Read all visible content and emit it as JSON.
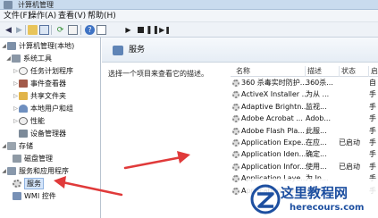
{
  "window": {
    "title": "计算机管理"
  },
  "menu": [
    "文件(F)",
    "操作(A)",
    "查看(V)",
    "帮助(H)"
  ],
  "toolbar": {
    "icons": [
      "back-arrow-icon",
      "forward-arrow-icon",
      "folder-up-icon",
      "console-tree-icon",
      "refresh-icon",
      "export-list-icon",
      "help-icon",
      "properties-icon",
      "play-icon",
      "stop-icon",
      "pause-icon",
      "restart-icon"
    ]
  },
  "tree": {
    "root": "计算机管理(本地)",
    "items": [
      {
        "label": "系统工具",
        "icon": "tools-icon"
      },
      {
        "label": "任务计划程序",
        "icon": "clock-icon"
      },
      {
        "label": "事件查看器",
        "icon": "event-viewer-icon"
      },
      {
        "label": "共享文件夹",
        "icon": "shared-folder-icon"
      },
      {
        "label": "本地用户和组",
        "icon": "users-icon"
      },
      {
        "label": "性能",
        "icon": "performance-icon"
      },
      {
        "label": "设备管理器",
        "icon": "device-manager-icon"
      },
      {
        "label": "存储",
        "icon": "storage-icon"
      },
      {
        "label": "磁盘管理",
        "icon": "disk-icon"
      },
      {
        "label": "服务和应用程序",
        "icon": "services-apps-icon"
      },
      {
        "label": "服务",
        "icon": "services-icon"
      },
      {
        "label": "WMI 控件",
        "icon": "wmi-icon"
      }
    ]
  },
  "center": {
    "title": "服务",
    "description": "选择一个项目来查看它的描述。"
  },
  "services": {
    "columns": [
      "名称",
      "描述",
      "状态",
      "启"
    ],
    "rows": [
      {
        "name": "360 杀毒实时防护...",
        "desc": "360杀...",
        "status": "",
        "start": "自"
      },
      {
        "name": "ActiveX Installer ...",
        "desc": "为从 ...",
        "status": "",
        "start": "手"
      },
      {
        "name": "Adaptive Brightn...",
        "desc": "监视...",
        "status": "",
        "start": "手"
      },
      {
        "name": "Adobe Acrobat ...",
        "desc": "Adob...",
        "status": "",
        "start": "手"
      },
      {
        "name": "Adobe Flash Pla...",
        "desc": "此服...",
        "status": "",
        "start": "手"
      },
      {
        "name": "Application Expe...",
        "desc": "在应...",
        "status": "已启动",
        "start": "手"
      },
      {
        "name": "Application Iden...",
        "desc": "确定...",
        "status": "",
        "start": "手"
      },
      {
        "name": "Application Infor...",
        "desc": "使用...",
        "status": "已启动",
        "start": "手"
      },
      {
        "name": "Application Laye...",
        "desc": "为 In...",
        "status": "",
        "start": "手"
      },
      {
        "name": "Application Man...",
        "desc": "为通...",
        "status": "",
        "start": "手"
      }
    ]
  },
  "watermark": {
    "title": "这里教程网",
    "url": "herecours.com"
  },
  "colors": {
    "arrow": "#e03a3a",
    "selection": "#d5e6fb",
    "watermark": "#1d4fa0"
  }
}
